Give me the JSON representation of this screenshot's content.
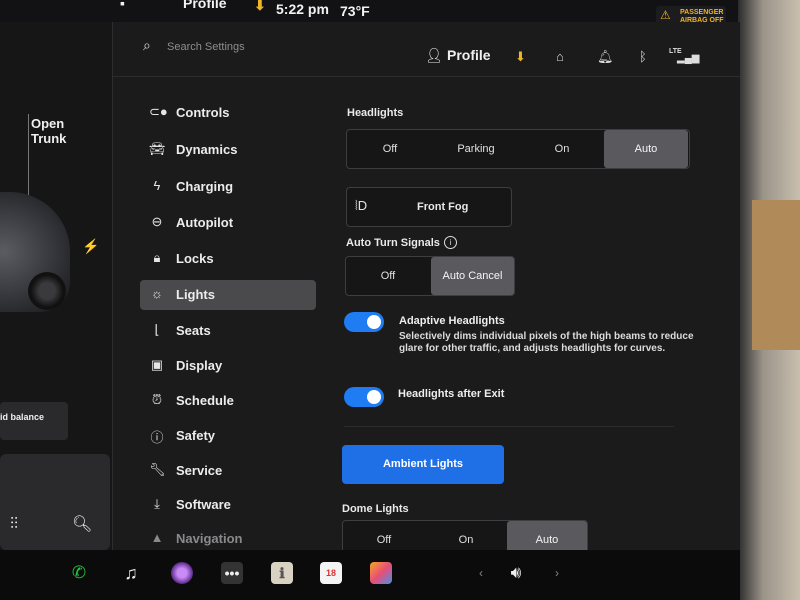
{
  "status": {
    "profile_label": "Profile",
    "time": "5:22 pm",
    "temperature": "73°F",
    "airbag_line1": "PASSENGER",
    "airbag_line2": "AIRBAG OFF"
  },
  "left_panel": {
    "trunk_label_1": "Open",
    "trunk_label_2": "Trunk",
    "balance_text": "id balance"
  },
  "topbar": {
    "search_placeholder": "Search Settings",
    "profile_label": "Profile",
    "lte_label": "LTE"
  },
  "sidebar": {
    "items": [
      {
        "label": "Controls",
        "icon": "toggle-icon"
      },
      {
        "label": "Dynamics",
        "icon": "car-icon"
      },
      {
        "label": "Charging",
        "icon": "bolt-icon"
      },
      {
        "label": "Autopilot",
        "icon": "steering-wheel-icon"
      },
      {
        "label": "Locks",
        "icon": "lock-icon"
      },
      {
        "label": "Lights",
        "icon": "sun-icon",
        "active": true
      },
      {
        "label": "Seats",
        "icon": "seat-icon"
      },
      {
        "label": "Display",
        "icon": "display-icon"
      },
      {
        "label": "Schedule",
        "icon": "alarm-icon"
      },
      {
        "label": "Safety",
        "icon": "safety-icon"
      },
      {
        "label": "Service",
        "icon": "wrench-icon"
      },
      {
        "label": "Software",
        "icon": "download-icon"
      },
      {
        "label": "Navigation",
        "icon": "navigation-icon"
      }
    ]
  },
  "lights": {
    "headlights_title": "Headlights",
    "headlights_options": [
      "Off",
      "Parking",
      "On",
      "Auto"
    ],
    "headlights_selected": "Auto",
    "front_fog_label": "Front Fog",
    "auto_turn_title": "Auto Turn Signals",
    "auto_turn_options": [
      "Off",
      "Auto Cancel"
    ],
    "auto_turn_selected": "Auto Cancel",
    "adaptive_title": "Adaptive Headlights",
    "adaptive_desc": "Selectively dims individual pixels of the high beams to reduce glare for other traffic, and adjusts headlights for curves.",
    "adaptive_on": true,
    "after_exit_title": "Headlights after Exit",
    "after_exit_on": true,
    "ambient_label": "Ambient Lights",
    "dome_title": "Dome Lights",
    "dome_options": [
      "Off",
      "On",
      "Auto"
    ],
    "dome_selected": "Auto"
  },
  "taskbar": {
    "calendar_day": "18"
  },
  "colors": {
    "accent": "#1f7cf2",
    "selected_segment": "#5a5a5e",
    "warning": "#f0b429"
  }
}
